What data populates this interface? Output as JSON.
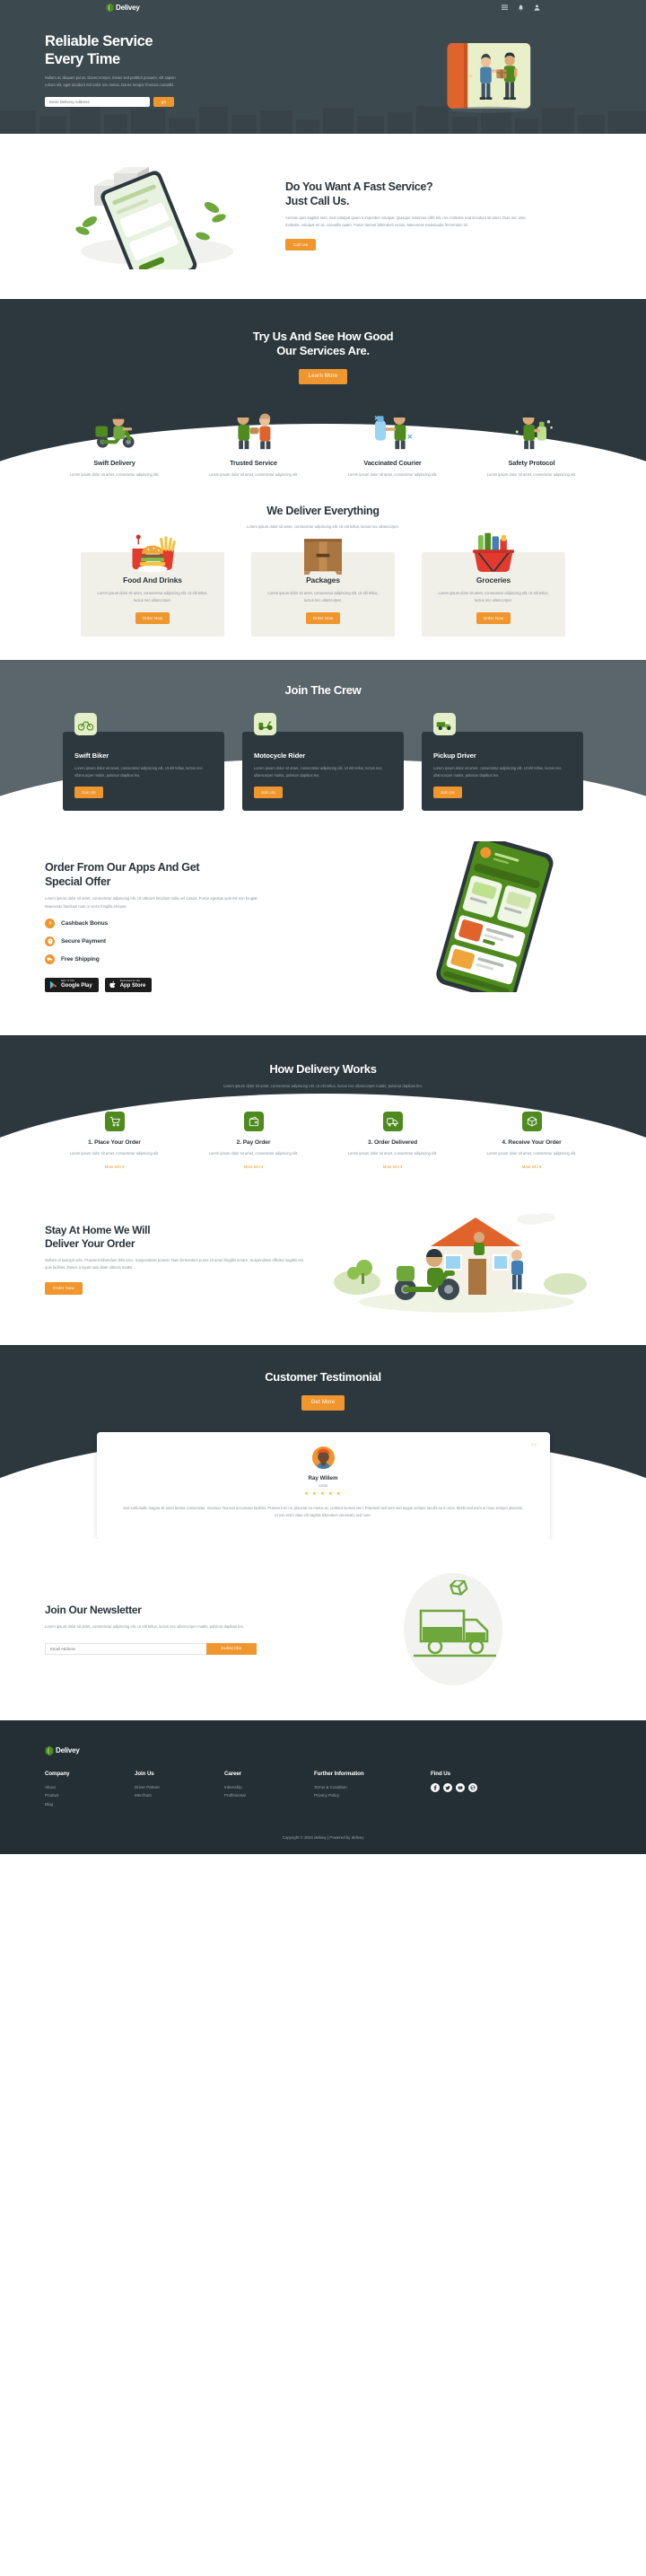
{
  "header": {
    "brand": "Delivey",
    "icons": [
      {
        "name": "menu-icon"
      },
      {
        "name": "bell-icon"
      },
      {
        "name": "user-icon"
      }
    ]
  },
  "hero": {
    "title_line1": "Reliable Service",
    "title_line2": "Every Time",
    "paragraph": "Nullam ac aliquam purus. Donec tempor, metus sed porttitor posuere, elit sapien rutrum elit, eget tincidunt nisl tortor nec metus. Donec tempor rhoncus convallis.",
    "search_placeholder": "Enter Delivery Address",
    "search_value": "",
    "go_label": "go"
  },
  "fast_service": {
    "title_line1": "Do You Want A Fast Service?",
    "title_line2": "Just Call Us.",
    "paragraph": "Aenean quis sagittis sem. Sed volutpat quam a imperdiet volutpat. Quisque maximus nibh elit, nec molestie erat tincidunt sit amet. Duis nec ante molestie, volutpat mi ac, convallis quam. Fusce laoreet bibendum luctus. Maecenas malesuada fermentum mi.",
    "button": "Call Us"
  },
  "services": {
    "title_line1": "Try Us And See How Good",
    "title_line2": "Our Services Are.",
    "button": "Learn More",
    "items": [
      {
        "icon": "scooter-courier-icon",
        "title": "Swift Delivery",
        "desc": "Lorem ipsum dolor sit amet, consectetur adipiscing elit."
      },
      {
        "icon": "handshake-courier-icon",
        "title": "Trusted Service",
        "desc": "Lorem ipsum dolor sit amet, consectetur adipiscing elit."
      },
      {
        "icon": "vaccine-courier-icon",
        "title": "Vaccinated Courier",
        "desc": "Lorem ipsum dolor sit amet, consectetur adipiscing elit."
      },
      {
        "icon": "sanitizer-courier-icon",
        "title": "Safety Protocol",
        "desc": "Lorem ipsum dolor sit amet, consectetur adipiscing elit."
      }
    ]
  },
  "everything": {
    "title": "We Deliver Everything",
    "subtitle": "Lorem ipsum dolor sit amet, consectetur adipiscing elit. Ut elit tellus, luctus nec ullamcorper.",
    "cards": [
      {
        "icon": "burger-fries-drink-icon",
        "title": "Food And Drinks",
        "desc": "Lorem ipsum dolor sit amet, consectetur adipiscing elit. Ut elit tellus, luctus nec ullamcorper.",
        "button": "Order Now"
      },
      {
        "icon": "cardboard-box-icon",
        "title": "Packages",
        "desc": "Lorem ipsum dolor sit amet, consectetur adipiscing elit. Ut elit tellus, luctus nec ullamcorper.",
        "button": "Order Now"
      },
      {
        "icon": "grocery-basket-icon",
        "title": "Groceries",
        "desc": "Lorem ipsum dolor sit amet, consectetur adipiscing elit. Ut elit tellus, luctus nec ullamcorper.",
        "button": "Order Now"
      }
    ]
  },
  "crew": {
    "title": "Join The Crew",
    "cards": [
      {
        "icon": "bicycle-icon",
        "title": "Swift Biker",
        "desc": "Lorem ipsum dolor sit amet, consectetur adipiscing elit. Ut elit tellus, luctus nec ullamcorper mattis, pulvinar dapibus leo.",
        "button": "Join Us"
      },
      {
        "icon": "scooter-icon",
        "title": "Motocycle Rider",
        "desc": "Lorem ipsum dolor sit amet, consectetur adipiscing elit. Ut elit tellus, luctus nec ullamcorper mattis, pulvinar dapibus leo.",
        "button": "Join Us"
      },
      {
        "icon": "pickup-truck-icon",
        "title": "Pickup Driver",
        "desc": "Lorem ipsum dolor sit amet, consectetur adipiscing elit. Ut elit tellus, luctus nec ullamcorper mattis, pulvinar dapibus leo.",
        "button": "Join Us"
      }
    ]
  },
  "apps": {
    "title_line1": "Order From Our Apps And Get",
    "title_line2": "Special Offer",
    "paragraph": "Lorem ipsum dolor sit amet, consectetur adipiscing elit. Ut ultricies tincidunt nulla vel cursus. Fusce egestas quis est non feugiat. Maecenas faucibus nunc in enim fringilla semper.",
    "features": [
      {
        "icon": "dollar-icon",
        "label": "Cashback Bonus"
      },
      {
        "icon": "shield-icon",
        "label": "Secure Payment"
      },
      {
        "icon": "truck-icon",
        "label": "Free Shipping"
      }
    ],
    "stores": [
      {
        "icon": "google-play-icon",
        "small": "GET IT ON",
        "big": "Google Play"
      },
      {
        "icon": "apple-icon",
        "small": "Download on the",
        "big": "App Store"
      }
    ]
  },
  "how": {
    "title": "How Delivery Works",
    "subtitle": "Lorem ipsum dolor sit amet, consectetur adipiscing elit. Ut elit tellus, luctus nec ullamcorper mattis, pulvinar dapibus leo.",
    "steps": [
      {
        "icon": "cart-icon",
        "title": "1. Place Your Order",
        "desc": "Lorem ipsum dolor sit amet, consectetur adipiscing elit.",
        "link": "More Info"
      },
      {
        "icon": "wallet-icon",
        "title": "2. Pay Order",
        "desc": "Lorem ipsum dolor sit amet, consectetur adipiscing elit.",
        "link": "More Info"
      },
      {
        "icon": "delivery-truck-icon",
        "title": "3. Order Delivered",
        "desc": "Lorem ipsum dolor sit amet, consectetur adipiscing elit.",
        "link": "More Info"
      },
      {
        "icon": "parcel-icon",
        "title": "4. Receive Your Order",
        "desc": "Lorem ipsum dolor sit amet, consectetur adipiscing elit.",
        "link": "More Info"
      }
    ]
  },
  "stay": {
    "title_line1": "Stay At Home We Will",
    "title_line2": "Deliver Your Order",
    "paragraph": "Nullam et suscipit odio. Praesent bibendum felis arcu. Suspendisse potenti. Nam fermentum purus sit amet fringilla ornare. Suspendisse efficitur sagittis est quis facilisis. Donec a ligula quis diam ultrices mattis.",
    "button": "Order Now"
  },
  "testimonial": {
    "title": "Customer Testimonial",
    "button": "Get More",
    "name": "Ray Willem",
    "role": "Artist",
    "rating": 5,
    "stars": "★ ★ ★ ★ ★",
    "quote": "Sed sollicitudin magna sit amet lacinia consectetur. Vivamus rhoncus accumsan facilisis. Praesent mi mi, placerat eu metus ac, porttitor laoreet sem. Praesent sed sem sed augue semper iaculis eu in eros. Morbi sed enim at risus semper placerat. Ut non enim vitae elit sagittis bibendum venenatis sed nunc."
  },
  "newsletter": {
    "title": "Join Our Newsletter",
    "paragraph": "Lorem ipsum dolor sit amet, consectetur adipiscing elit. Ut elit tellus, luctus nec ullamcorper mattis, pulvinar dapibus leo.",
    "placeholder": "Email Address",
    "value": "",
    "button": "Subscribe"
  },
  "footer": {
    "brand": "Delivey",
    "columns": [
      {
        "heading": "Company",
        "links": [
          "About",
          "Product",
          "Blog"
        ]
      },
      {
        "heading": "Join Us",
        "links": [
          "Driver Partner",
          "Merchant"
        ]
      },
      {
        "heading": "Career",
        "links": [
          "Internship",
          "Proffesional"
        ]
      },
      {
        "heading": "Further Information",
        "links": [
          "Terms & Condition",
          "Privacy Policy"
        ]
      }
    ],
    "find_us": "Find Us",
    "socials": [
      "facebook-icon",
      "twitter-icon",
      "youtube-icon",
      "wordpress-icon"
    ],
    "copyright": "Copyright © 2024 delivey | Powered by delivey"
  },
  "colors": {
    "dark": "#2c383e",
    "slate": "#3c494f",
    "gray": "#5b666c",
    "accent": "#f0962e",
    "green": "#4e8a1e",
    "footer": "#232f35"
  }
}
